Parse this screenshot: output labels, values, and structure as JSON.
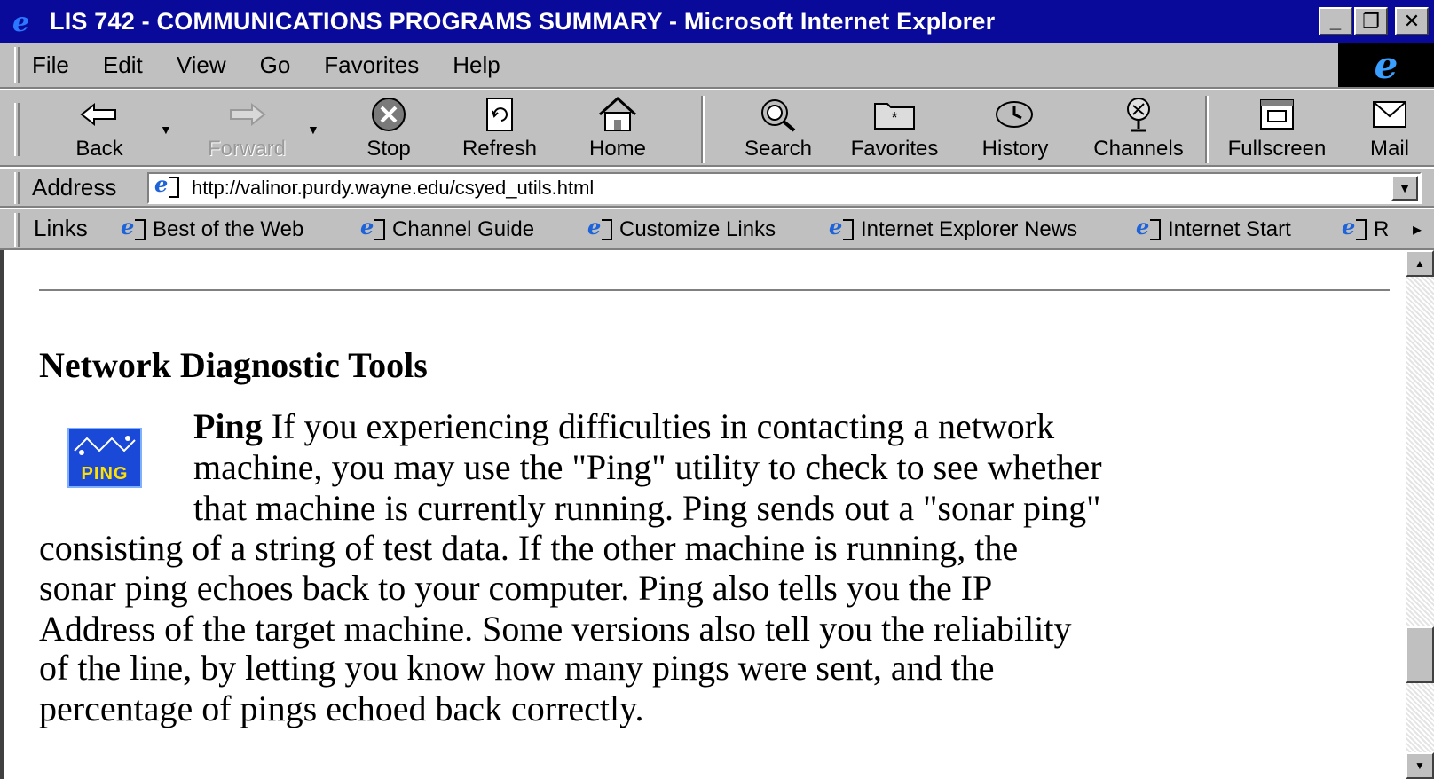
{
  "window": {
    "title": "LIS 742 - COMMUNICATIONS PROGRAMS SUMMARY - Microsoft Internet Explorer",
    "min_glyph": "_",
    "max_glyph": "❐",
    "close_glyph": "✕"
  },
  "menu": {
    "items": [
      "File",
      "Edit",
      "View",
      "Go",
      "Favorites",
      "Help"
    ]
  },
  "toolbar": {
    "back": "Back",
    "forward": "Forward",
    "stop": "Stop",
    "refresh": "Refresh",
    "home": "Home",
    "search": "Search",
    "favorites": "Favorites",
    "history": "History",
    "channels": "Channels",
    "fullscreen": "Fullscreen",
    "mail": "Mail"
  },
  "address": {
    "label": "Address",
    "url": "http://valinor.purdy.wayne.edu/csyed_utils.html"
  },
  "links": {
    "label": "Links",
    "items": [
      "Best of the Web",
      "Channel Guide",
      "Customize Links",
      "Internet Explorer News",
      "Internet Start",
      "R"
    ],
    "more": "▸"
  },
  "page": {
    "heading": "Network Diagnostic Tools",
    "ping_icon_text": "PING",
    "ping_bold": "Ping",
    "lines": [
      " If you experiencing difficulties in contacting a network",
      "machine, you may use the \"Ping\" utility to check to see whether",
      "that machine is currently running. Ping sends out a \"sonar ping\"",
      "consisting of a string of test data. If the other machine is running, the",
      "sonar ping echoes back to your computer. Ping also tells you the IP",
      "Address of the target machine. Some versions also tell you the reliability",
      "of the line, by letting you know how many pings were sent, and the",
      "percentage of pings echoed back correctly."
    ]
  },
  "scrollbar": {
    "up_glyph": "▲",
    "down_glyph": "▼"
  }
}
